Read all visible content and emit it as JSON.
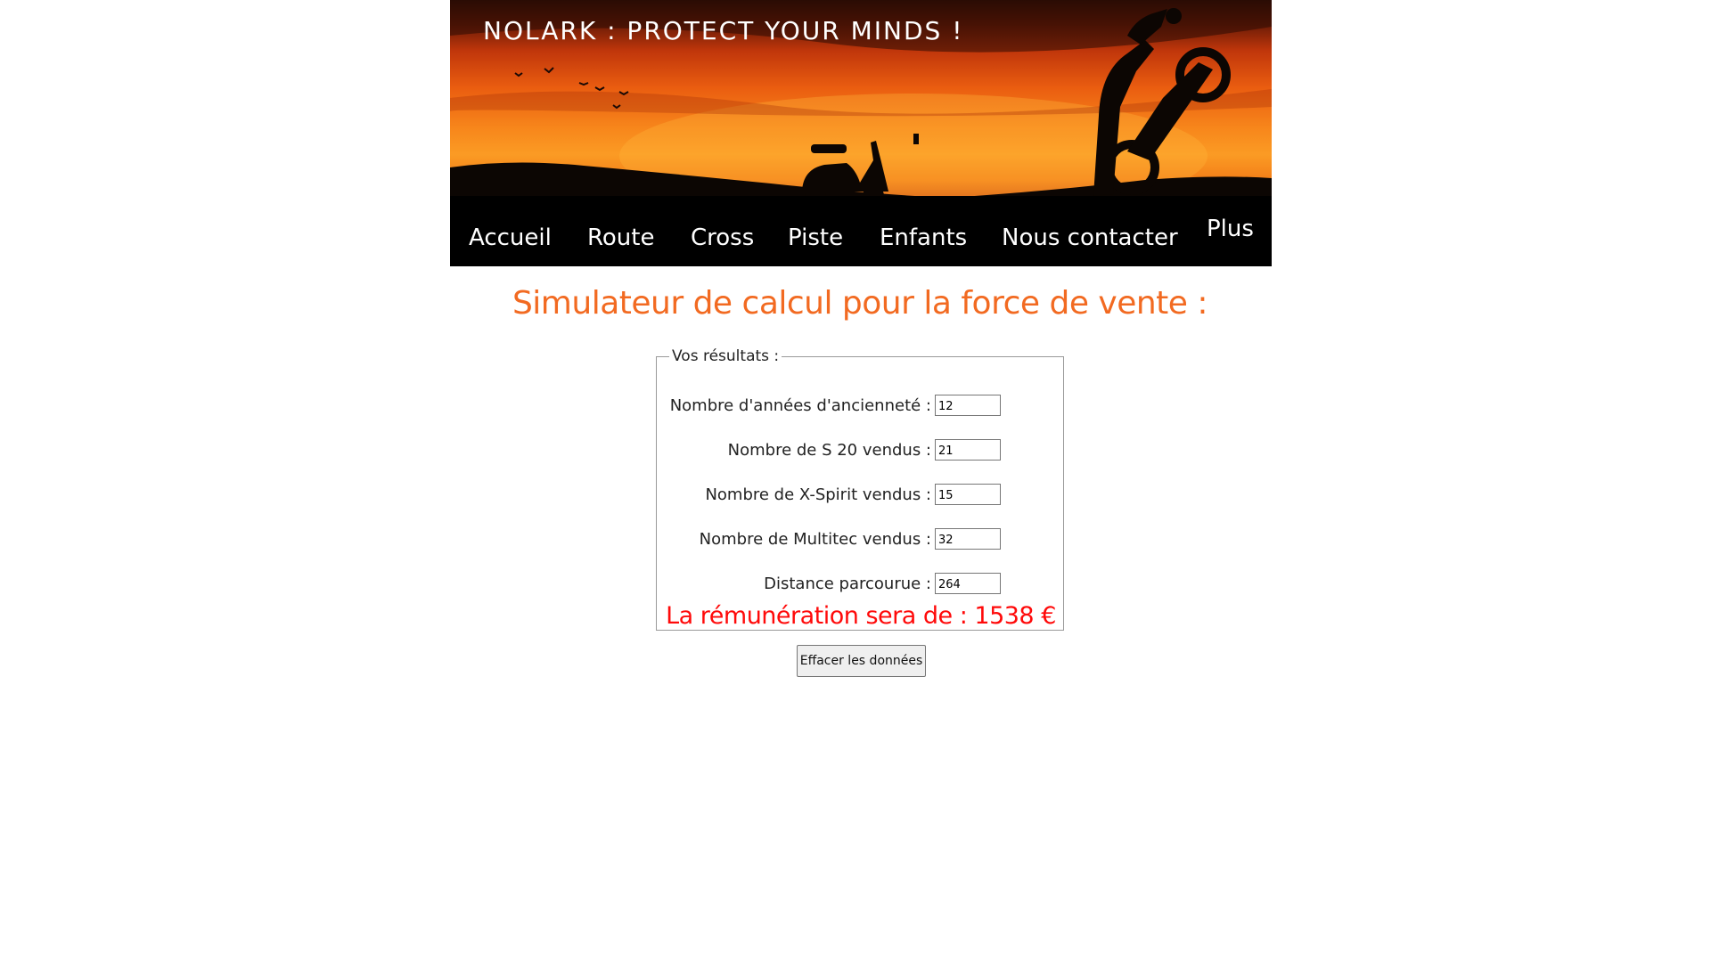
{
  "header": {
    "site_title": "NOLARK : PROTECT YOUR MINDS !",
    "nav": [
      "Accueil",
      "Route",
      "Cross",
      "Piste",
      "Enfants",
      "Nous contacter",
      "Plus"
    ]
  },
  "main": {
    "title": "Simulateur de calcul pour la force de vente :",
    "form": {
      "legend": "Vos résultats :",
      "fields": [
        {
          "label": "Nombre d'années d'ancienneté :",
          "value": "12"
        },
        {
          "label": "Nombre de S 20 vendus :",
          "value": "21"
        },
        {
          "label": "Nombre de X-Spirit vendus :",
          "value": "15"
        },
        {
          "label": "Nombre de Multitec vendus :",
          "value": "32"
        },
        {
          "label": "Distance parcourue :",
          "value": "264"
        }
      ],
      "result": "La rémunération sera de : 1538 €"
    },
    "clear_button": "Effacer les données"
  },
  "colors": {
    "title": "#f26a21",
    "result": "#ff0a0a",
    "nav_background": "#000000",
    "nav_text": "#ffffff"
  },
  "icons": [
    "bird-icon",
    "scooter-silhouette",
    "motorbike-silhouette"
  ]
}
